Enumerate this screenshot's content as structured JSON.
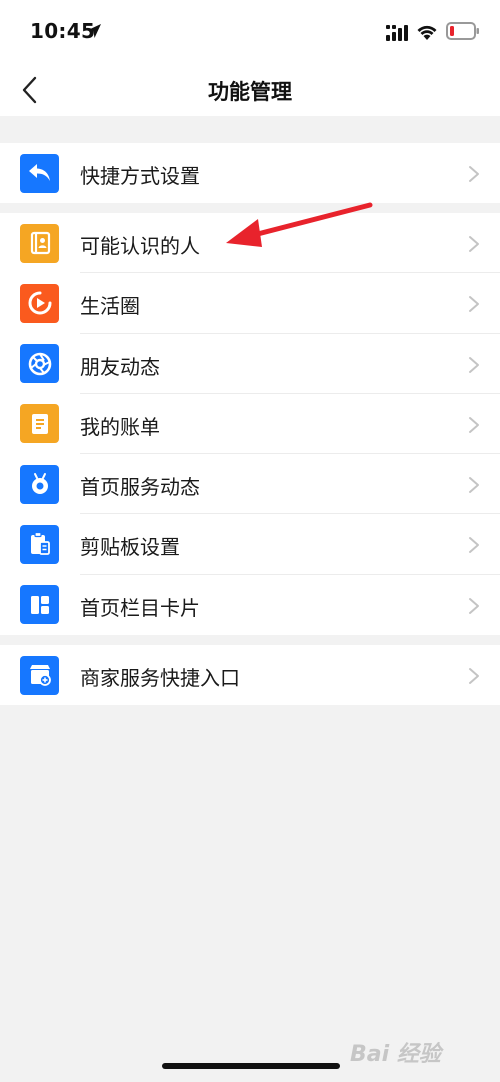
{
  "status_bar": {
    "time": "10:45"
  },
  "nav": {
    "title": "功能管理"
  },
  "groups": [
    {
      "items": [
        {
          "label": "快捷方式设置",
          "icon": "shortcut-reply-icon",
          "color": "#1677ff"
        }
      ]
    },
    {
      "items": [
        {
          "label": "可能认识的人",
          "icon": "contacts-book-icon",
          "color": "#f5a623"
        },
        {
          "label": "生活圈",
          "icon": "life-circle-play-icon",
          "color": "#fa5a1e"
        },
        {
          "label": "朋友动态",
          "icon": "aperture-icon",
          "color": "#1677ff"
        },
        {
          "label": "我的账单",
          "icon": "bill-icon",
          "color": "#f5a623"
        },
        {
          "label": "首页服务动态",
          "icon": "service-bot-icon",
          "color": "#1677ff"
        },
        {
          "label": "剪贴板设置",
          "icon": "clipboard-icon",
          "color": "#1677ff"
        },
        {
          "label": "首页栏目卡片",
          "icon": "card-grid-icon",
          "color": "#1677ff"
        }
      ]
    },
    {
      "items": [
        {
          "label": "商家服务快捷入口",
          "icon": "merchant-store-icon",
          "color": "#1677ff"
        }
      ]
    }
  ],
  "watermark": "Bai 经验",
  "colors": {
    "annotation_arrow": "#e8232c",
    "background": "#f2f2f2"
  }
}
